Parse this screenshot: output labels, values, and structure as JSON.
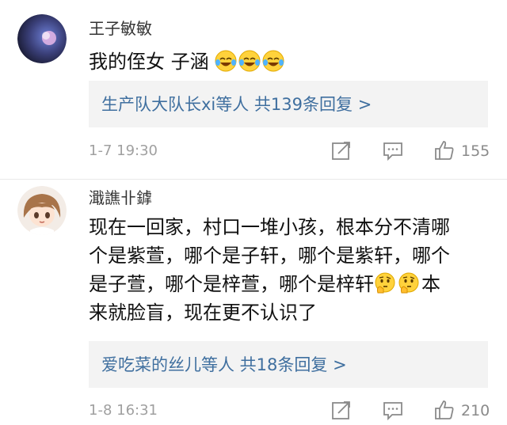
{
  "comments": [
    {
      "username": "王子敏敏",
      "text_main": "我的侄女 子涵",
      "emojis": [
        "crying-laughing-face",
        "crying-laughing-face",
        "crying-laughing-face"
      ],
      "reply_link": "生产队大队长xi等人 共139条回复 >",
      "timestamp": "1-7 19:30",
      "likes": "155"
    },
    {
      "username": "濈譙卝鎼",
      "text_lines": [
        "现在一回家，村口一堆小孩，根本分不清哪",
        "个是紫萱，哪个是子轩，哪个是紫轩，哪个"
      ],
      "text_line3_prefix": "是子萱，哪个是梓萱，哪个是梓轩",
      "text_line3_suffix": "本",
      "text_line4": "来就脸盲，现在更不认识了",
      "emojis": [
        "thinking-face",
        "thinking-face"
      ],
      "reply_link": "爱吃菜的丝儿等人 共18条回复 >",
      "timestamp": "1-8 16:31",
      "likes": "210"
    }
  ],
  "colors": {
    "link": "#3f6f9f",
    "reply_bg": "#f3f3f3",
    "muted": "#a0a0a0",
    "emoji_yellow": "#ffd23c"
  }
}
